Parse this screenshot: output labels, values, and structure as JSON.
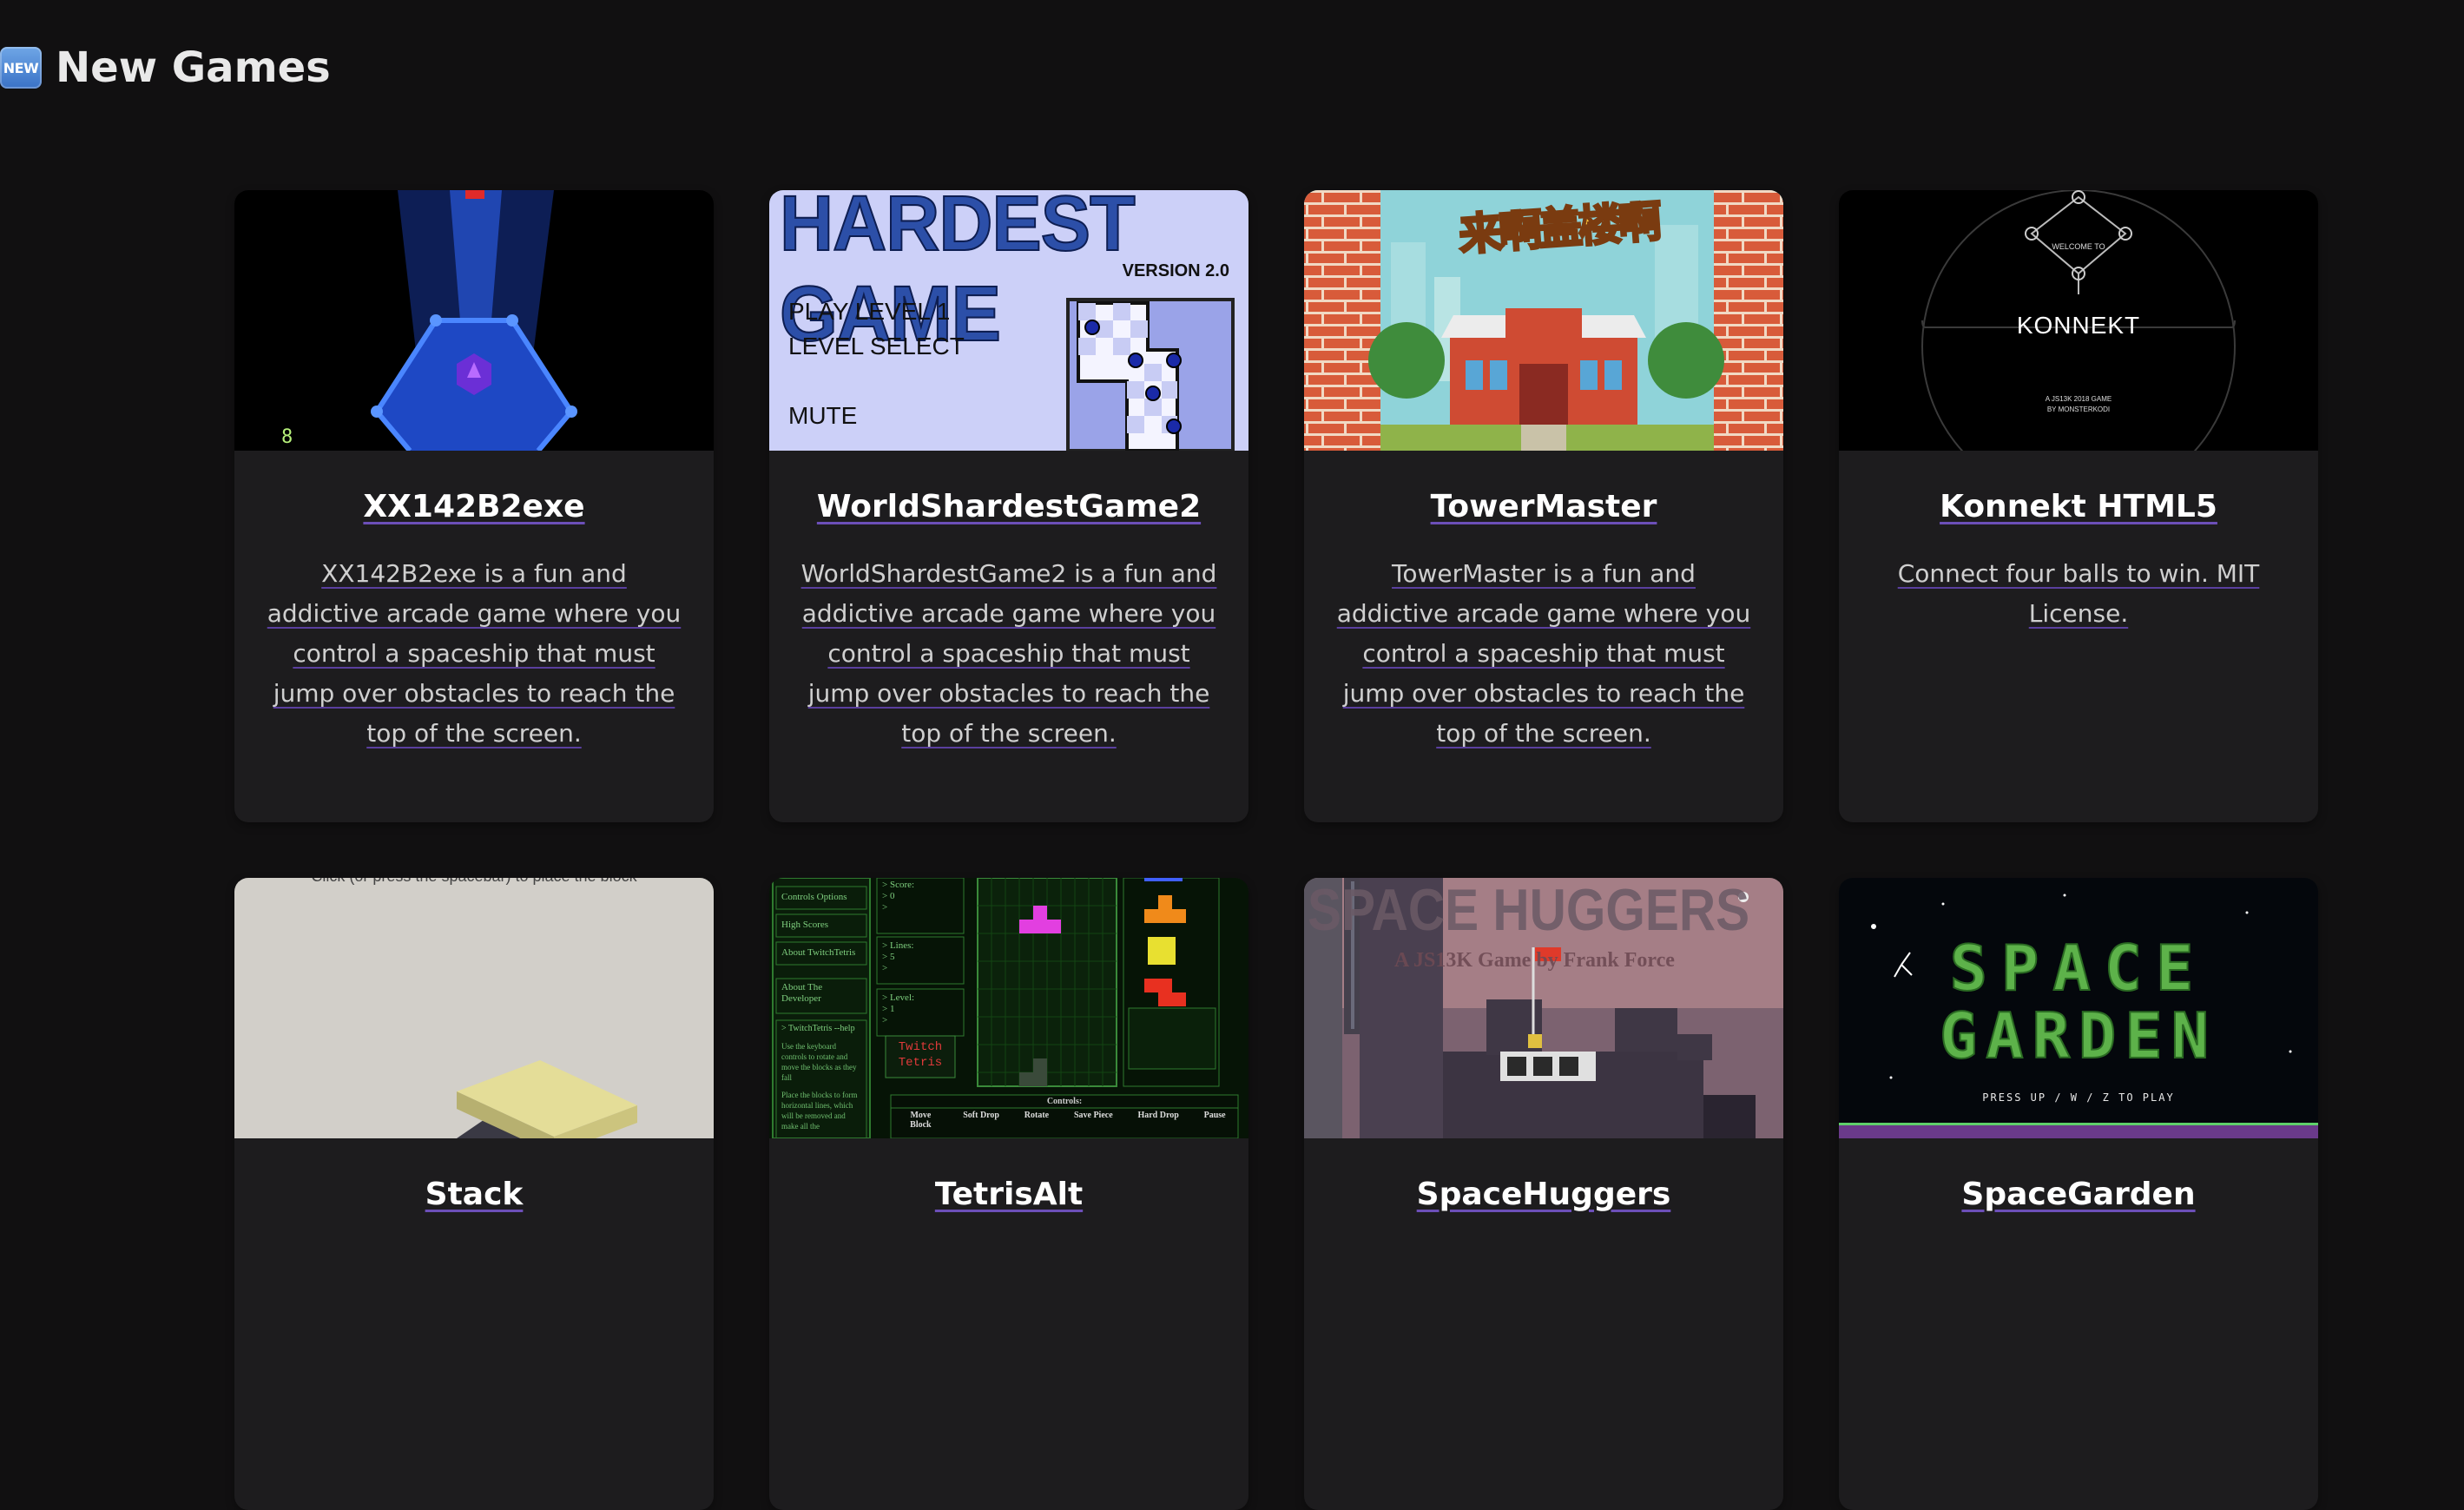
{
  "header": {
    "badge": "NEW",
    "title": "New Games"
  },
  "games": [
    {
      "title": "XX142B2exe",
      "description": "XX142B2exe is a fun and addictive arcade game where you control a spaceship that must jump over obstacles to reach the top of the screen.",
      "thumb": {
        "counter": "8"
      }
    },
    {
      "title": "WorldShardestGame2",
      "description": "WorldShardestGame2 is a fun and addictive arcade game where you control a spaceship that must jump over obstacles to reach the top of the screen.",
      "thumb": {
        "logo": "HARDEST GAME",
        "version": "VERSION 2.0",
        "menu": [
          "PLAY LEVEL 1",
          "LEVEL SELECT",
          "MUTE"
        ]
      }
    },
    {
      "title": "TowerMaster",
      "description": "TowerMaster is a fun and addictive arcade game where you control a spaceship that must jump over obstacles to reach the top of the screen.",
      "thumb": {
        "logo": "来啊盖楼啊"
      }
    },
    {
      "title": "Konnekt HTML5",
      "description": "Connect four balls to win. MIT License.",
      "thumb": {
        "welcome": "WELCOME TO",
        "name": "KONNEKT",
        "credit1": "A JS13K 2018 GAME",
        "credit2": "BY MONSTERKODI"
      }
    },
    {
      "title": "Stack",
      "description": "",
      "thumb": {
        "hint": "Click (or press the spacebar) to place the block"
      }
    },
    {
      "title": "TetrisAlt",
      "description": "",
      "thumb": {
        "menu": [
          "Controls Options",
          "High Scores",
          "About TwitchTetris",
          "About The Developer"
        ],
        "help": "> TwitchTetris --help",
        "help_text": "Use the keyboard controls to rotate and move the blocks as they fall",
        "help_text2": "Place the blocks to form horizontal lines, which will be removed and make all the",
        "score": [
          "> Score:",
          "> 0",
          ">"
        ],
        "lines": [
          "> Lines:",
          "> 5",
          ">"
        ],
        "level": [
          "> Level:",
          "> 1",
          ">"
        ],
        "logo": [
          "Twitch",
          "Tetris"
        ],
        "controls_title": "Controls:",
        "controls": [
          "Move Block",
          "Soft Drop",
          "Rotate",
          "Save Piece",
          "Hard Drop",
          "Pause"
        ]
      }
    },
    {
      "title": "SpaceHuggers",
      "description": "",
      "thumb": {
        "logo": "SPACE HUGGERS",
        "sub": "A JS13K Game by Frank Force"
      }
    },
    {
      "title": "SpaceGarden",
      "description": "",
      "thumb": {
        "line1": "SPACE",
        "line2": "GARDEN",
        "prompt": "PRESS UP / W / Z TO PLAY"
      }
    }
  ]
}
